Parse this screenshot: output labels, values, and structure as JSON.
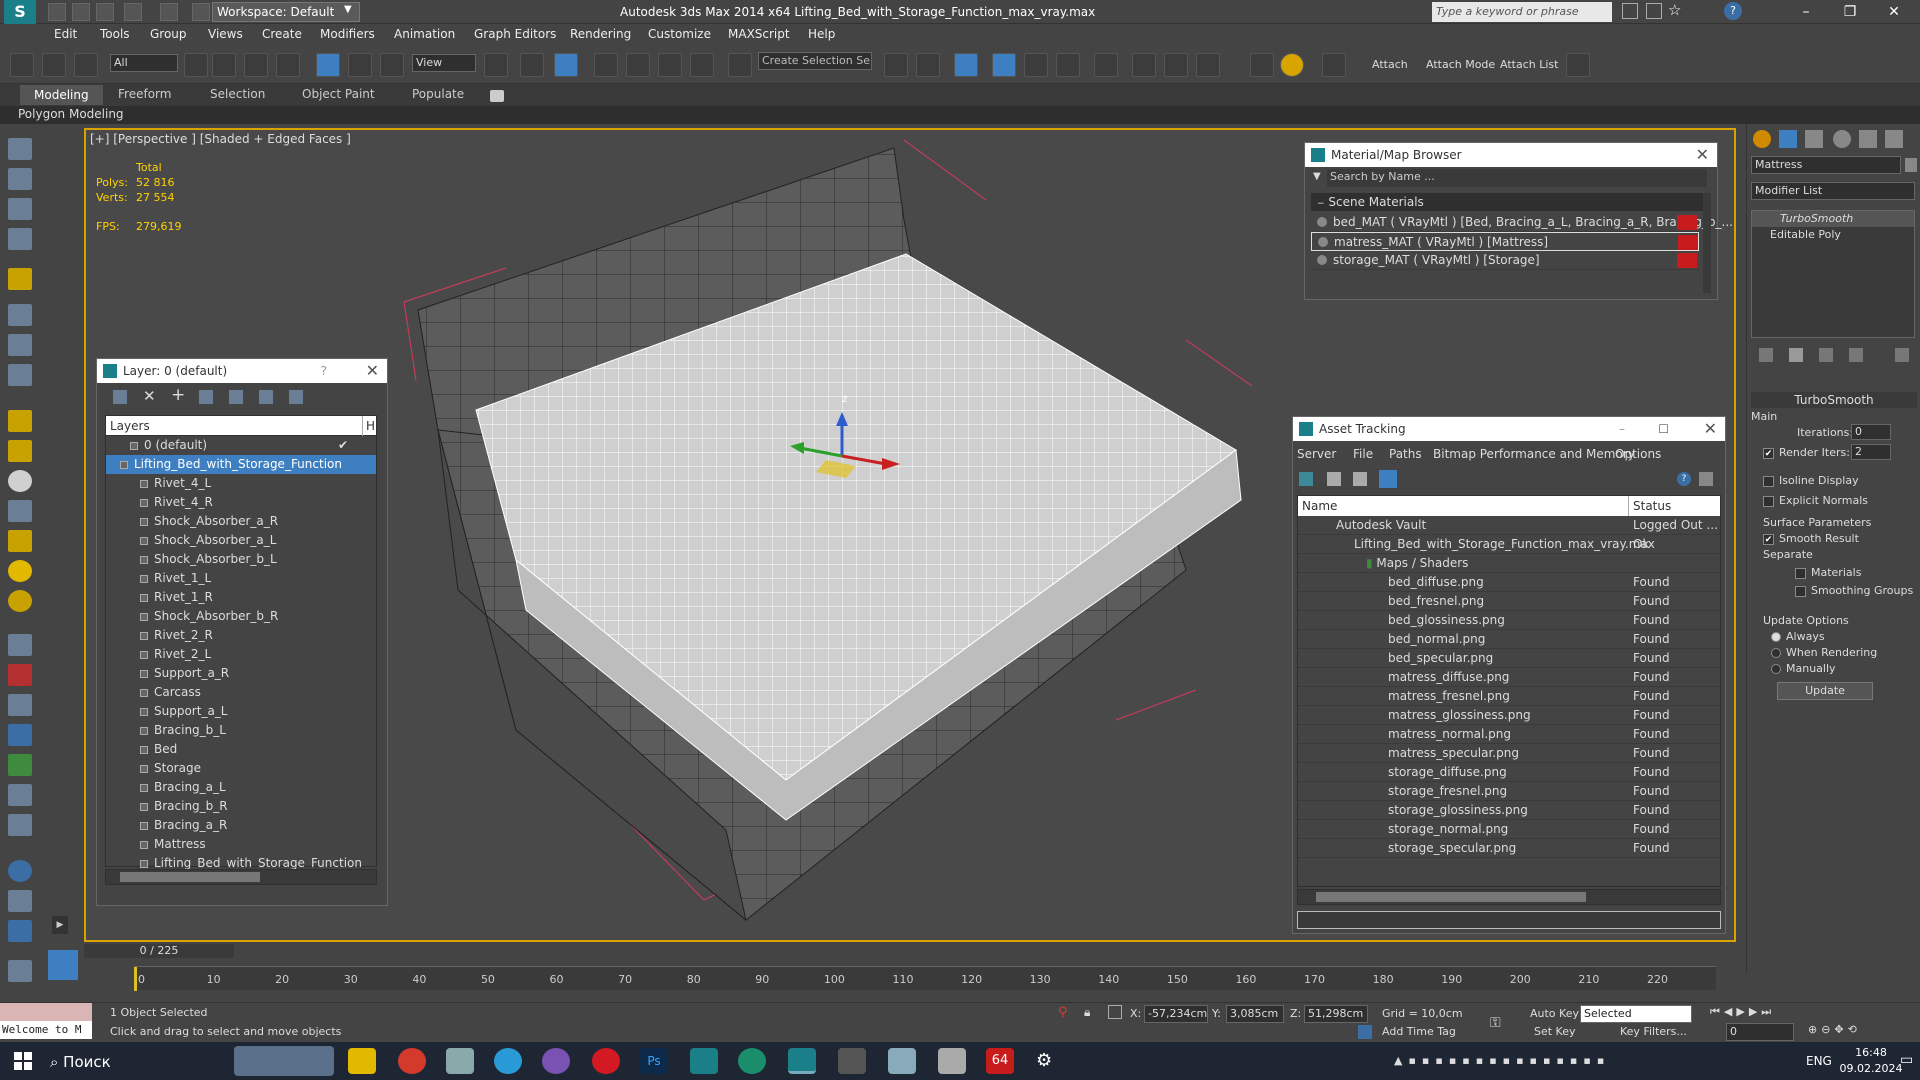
{
  "app": {
    "workspace": "Workspace: Default",
    "window_title": "Autodesk 3ds Max  2014 x64      Lifting_Bed_with_Storage_Function_max_vray.max",
    "search_placeholder": "Type a keyword or phrase"
  },
  "menu": [
    "Edit",
    "Tools",
    "Group",
    "Views",
    "Create",
    "Modifiers",
    "Animation",
    "Graph Editors",
    "Rendering",
    "Customize",
    "MAXScript",
    "Help"
  ],
  "toolbar": {
    "selection_filter": "All",
    "ref_coord": "View",
    "named_selection": "Create Selection Se",
    "attach": "Attach",
    "attach_mode": "Attach Mode",
    "attach_list": "Attach List"
  },
  "ribbon": {
    "tabs": [
      "Modeling",
      "Freeform",
      "Selection",
      "Object Paint",
      "Populate"
    ],
    "panel": "Polygon Modeling"
  },
  "viewport": {
    "label": "[+] [Perspective ] [Shaded + Edged Faces ]",
    "stats_total": "Total",
    "polys_label": "Polys:",
    "polys": "52 816",
    "verts_label": "Verts:",
    "verts": "27 554",
    "fps_label": "FPS:",
    "fps": "279,619",
    "gizmo_z": "z"
  },
  "layer_window": {
    "title": "Layer: 0 (default)",
    "help": "?",
    "col_layers": "Layers",
    "col_hide": "Hi",
    "items": [
      "0 (default)",
      "Lifting_Bed_with_Storage_Function",
      "Rivet_4_L",
      "Rivet_4_R",
      "Shock_Absorber_a_R",
      "Shock_Absorber_a_L",
      "Shock_Absorber_b_L",
      "Rivet_1_L",
      "Rivet_1_R",
      "Shock_Absorber_b_R",
      "Rivet_2_R",
      "Rivet_2_L",
      "Support_a_R",
      "Carcass",
      "Support_a_L",
      "Bracing_b_L",
      "Bed",
      "Storage",
      "Bracing_a_L",
      "Bracing_b_R",
      "Bracing_a_R",
      "Mattress",
      "Lifting_Bed_with_Storage_Function"
    ]
  },
  "material_browser": {
    "title": "Material/Map Browser",
    "search_placeholder": "Search by Name ...",
    "section": "Scene Materials",
    "items": [
      "bed_MAT  ( VRayMtl ) [Bed, Bracing_a_L, Bracing_a_R, Bracing_b_...",
      "matress_MAT  ( VRayMtl ) [Mattress]",
      "storage_MAT  ( VRayMtl ) [Storage]"
    ]
  },
  "asset_tracking": {
    "title": "Asset Tracking",
    "menu": [
      "Server",
      "File",
      "Paths",
      "Bitmap Performance and Memory",
      "Options"
    ],
    "col_name": "Name",
    "col_status": "Status",
    "vault": {
      "name": "Autodesk Vault",
      "status": "Logged Out ..."
    },
    "file": {
      "name": "Lifting_Bed_with_Storage_Function_max_vray.max",
      "status": "Ok"
    },
    "folder": "Maps / Shaders",
    "maps": [
      {
        "name": "bed_diffuse.png",
        "status": "Found"
      },
      {
        "name": "bed_fresnel.png",
        "status": "Found"
      },
      {
        "name": "bed_glossiness.png",
        "status": "Found"
      },
      {
        "name": "bed_normal.png",
        "status": "Found"
      },
      {
        "name": "bed_specular.png",
        "status": "Found"
      },
      {
        "name": "matress_diffuse.png",
        "status": "Found"
      },
      {
        "name": "matress_fresnel.png",
        "status": "Found"
      },
      {
        "name": "matress_glossiness.png",
        "status": "Found"
      },
      {
        "name": "matress_normal.png",
        "status": "Found"
      },
      {
        "name": "matress_specular.png",
        "status": "Found"
      },
      {
        "name": "storage_diffuse.png",
        "status": "Found"
      },
      {
        "name": "storage_fresnel.png",
        "status": "Found"
      },
      {
        "name": "storage_glossiness.png",
        "status": "Found"
      },
      {
        "name": "storage_normal.png",
        "status": "Found"
      },
      {
        "name": "storage_specular.png",
        "status": "Found"
      }
    ]
  },
  "command_panel": {
    "object_name": "Mattress",
    "modifier_list": "Modifier List",
    "stack": [
      "TurboSmooth",
      "Editable Poly"
    ],
    "rollout": "TurboSmooth",
    "main": "Main",
    "iterations_label": "Iterations:",
    "iterations": "0",
    "render_iters_label": "Render Iters:",
    "render_iters": "2",
    "isoline": "Isoline Display",
    "explicit_normals": "Explicit Normals",
    "surface_params": "Surface Parameters",
    "smooth_result": "Smooth Result",
    "separate": "Separate",
    "materials": "Materials",
    "smoothing_groups": "Smoothing Groups",
    "update_options": "Update Options",
    "always": "Always",
    "when_rendering": "When Rendering",
    "manually": "Manually",
    "update_btn": "Update"
  },
  "timeline": {
    "frame": "0 / 225",
    "ticks": [
      "0",
      "10",
      "20",
      "30",
      "40",
      "50",
      "60",
      "70",
      "80",
      "90",
      "100",
      "110",
      "120",
      "130",
      "140",
      "150",
      "160",
      "170",
      "180",
      "190",
      "200",
      "210",
      "220"
    ]
  },
  "status": {
    "maxscript": "Welcome to M",
    "selected": "1 Object Selected",
    "prompt": "Click and drag to select and move objects",
    "x_label": "X:",
    "x": "-57,234cm",
    "y_label": "Y:",
    "y": "3,085cm",
    "z_label": "Z:",
    "z": "51,298cm",
    "grid": "Grid = 10,0cm",
    "add_time_tag": "Add Time Tag",
    "auto_key": "Auto Key",
    "set_key": "Set Key",
    "key_mode": "Selected",
    "key_filters": "Key Filters...",
    "frame_field": "0"
  },
  "taskbar": {
    "search": "Поиск",
    "lang": "ENG",
    "time": "16:48",
    "date": "09.02.2024",
    "badge": "64"
  }
}
